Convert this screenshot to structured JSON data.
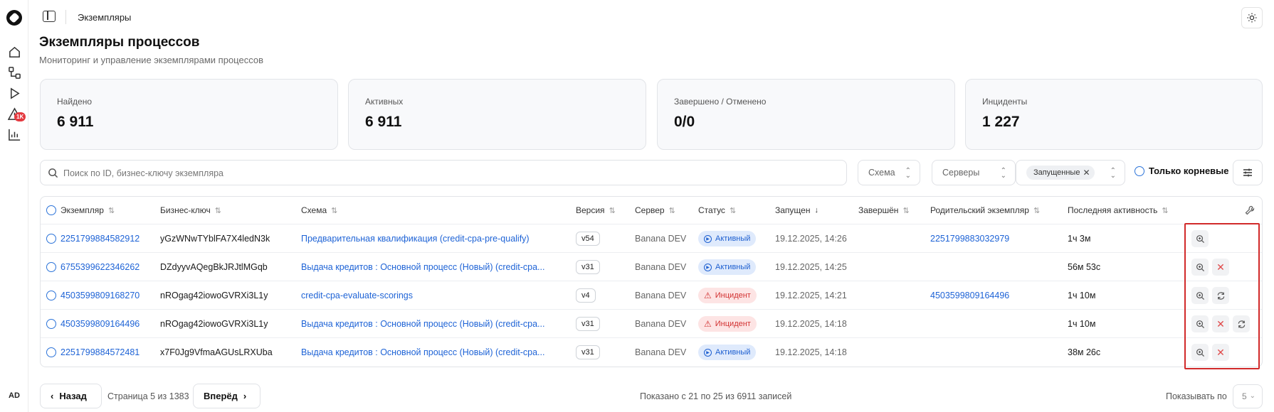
{
  "breadcrumb": "Экземпляры",
  "page": {
    "title": "Экземпляры процессов",
    "subtitle": "Мониторинг и управление экземплярами процессов"
  },
  "nav": {
    "alert_badge": "1K",
    "avatar": "AD"
  },
  "stats": [
    {
      "label": "Найдено",
      "value": "6 911"
    },
    {
      "label": "Активных",
      "value": "6 911"
    },
    {
      "label": "Завершено / Отменено",
      "value": "0/0"
    },
    {
      "label": "Инциденты",
      "value": "1 227"
    }
  ],
  "filters": {
    "search_placeholder": "Поиск по ID, бизнес-ключу экземпляра",
    "schema_label": "Схема",
    "servers_label": "Серверы",
    "state_chip": "Запущенные",
    "root_only_label": "Только корневые"
  },
  "table": {
    "columns": [
      "Экземпляр",
      "Бизнес-ключ",
      "Схема",
      "Версия",
      "Сервер",
      "Статус",
      "Запущен",
      "Завершён",
      "Родительский экземпляр",
      "Последняя активность"
    ],
    "rows": [
      {
        "id": "2251799884582912",
        "key": "yGzWNwTYblFA7X4ledN3k",
        "schema": "Предварительная квалификация (credit-cpa-pre-qualify)",
        "version": "v54",
        "server": "Banana DEV",
        "status": "Активный",
        "status_type": "active",
        "started": "19.12.2025, 14:26",
        "finished": "",
        "parent": "2251799883032979",
        "last_activity": "1ч 3м",
        "actions": [
          "inspect-icon"
        ]
      },
      {
        "id": "6755399622346262",
        "key": "DZdyyvAQegBkJRJtlMGqb",
        "schema": "Выдача кредитов : Основной процесс (Новый) (credit-cpa...",
        "version": "v31",
        "server": "Banana DEV",
        "status": "Активный",
        "status_type": "active",
        "started": "19.12.2025, 14:25",
        "finished": "",
        "parent": "",
        "last_activity": "56м 53с",
        "actions": [
          "inspect-icon",
          "cancel-icon"
        ]
      },
      {
        "id": "4503599809168270",
        "key": "nROgag42iowoGVRXi3L1y",
        "schema": "credit-cpa-evaluate-scorings",
        "version": "v4",
        "server": "Banana DEV",
        "status": "Инцидент",
        "status_type": "incident",
        "started": "19.12.2025, 14:21",
        "finished": "",
        "parent": "4503599809164496",
        "last_activity": "1ч 10м",
        "actions": [
          "inspect-icon",
          "retry-icon"
        ]
      },
      {
        "id": "4503599809164496",
        "key": "nROgag42iowoGVRXi3L1y",
        "schema": "Выдача кредитов : Основной процесс (Новый) (credit-cpa...",
        "version": "v31",
        "server": "Banana DEV",
        "status": "Инцидент",
        "status_type": "incident",
        "started": "19.12.2025, 14:18",
        "finished": "",
        "parent": "",
        "last_activity": "1ч 10м",
        "actions": [
          "inspect-icon",
          "cancel-icon",
          "retry-icon"
        ]
      },
      {
        "id": "2251799884572481",
        "key": "x7F0Jg9VfmaAGUsLRXUba",
        "schema": "Выдача кредитов : Основной процесс (Новый) (credit-cpa...",
        "version": "v31",
        "server": "Banana DEV",
        "status": "Активный",
        "status_type": "active",
        "started": "19.12.2025, 14:18",
        "finished": "",
        "parent": "",
        "last_activity": "38м 26с",
        "actions": [
          "inspect-icon",
          "cancel-icon"
        ]
      }
    ]
  },
  "pagination": {
    "prev": "Назад",
    "page_info": "Страница 5 из 1383",
    "next": "Вперёд",
    "shown": "Показано с 21 по 25 из 6911 записей",
    "per_page_label": "Показывать по",
    "per_page_value": "5"
  },
  "colors": {
    "accent": "#1e63d6",
    "active_bg": "#dfeafc",
    "incident_bg": "#fde4e4",
    "incident": "#d23131",
    "highlight_box": "#d12a2a"
  }
}
